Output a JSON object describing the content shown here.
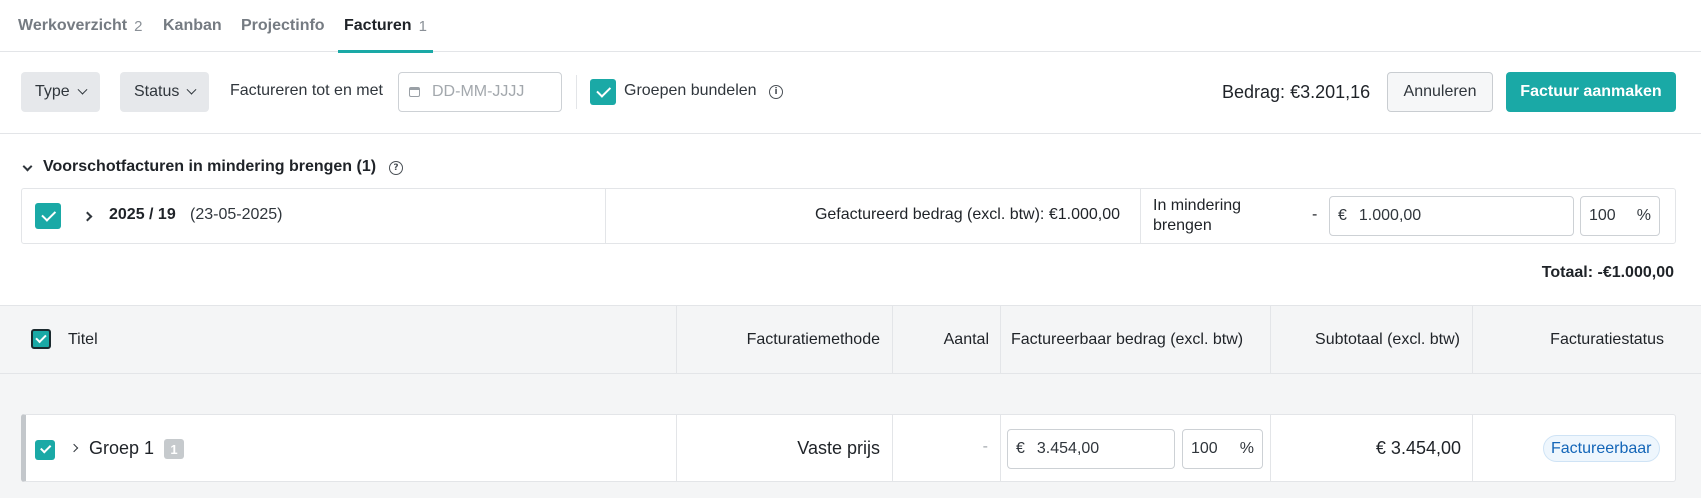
{
  "tabs": [
    {
      "label": "Werkoverzicht",
      "count": "2"
    },
    {
      "label": "Kanban",
      "count": ""
    },
    {
      "label": "Projectinfo",
      "count": ""
    },
    {
      "label": "Facturen",
      "count": "1"
    }
  ],
  "toolbar": {
    "type_label": "Type",
    "status_label": "Status",
    "invoice_until_label": "Factureren tot en met",
    "date_placeholder": "DD-MM-JJJJ",
    "bundle_groups_label": "Groepen bundelen",
    "amount_label": "Bedrag:",
    "amount_value": "€3.201,16",
    "cancel_label": "Annuleren",
    "create_label": "Factuur aanmaken"
  },
  "advance": {
    "section_title": "Voorschotfacturen in mindering brengen (1)",
    "row": {
      "number": "2025 / 19",
      "date": "(23-05-2025)",
      "invoiced_amount": "Gefactureerd bedrag (excl. btw): €1.000,00",
      "deduct_label_line1": "In mindering",
      "deduct_label_line2": "brengen",
      "minus": "-",
      "currency": "€",
      "amount": "1.000,00",
      "percent": "100",
      "percent_sign": "%"
    },
    "total": "Totaal: -€1.000,00"
  },
  "table": {
    "headers": {
      "title": "Titel",
      "method": "Facturatiemethode",
      "quantity": "Aantal",
      "billable": "Factureerbaar bedrag (excl. btw)",
      "subtotal": "Subtotaal (excl. btw)",
      "status": "Facturatiestatus"
    },
    "rows": [
      {
        "title": "Groep 1",
        "count": "1",
        "method": "Vaste prijs",
        "quantity": "-",
        "currency": "€",
        "amount": "3.454,00",
        "percent": "100",
        "percent_sign": "%",
        "subtotal": "€ 3.454,00",
        "status": "Factureerbaar"
      }
    ]
  },
  "colors": {
    "accent": "#1aa9a6",
    "status_pill_text": "#1466b8"
  }
}
